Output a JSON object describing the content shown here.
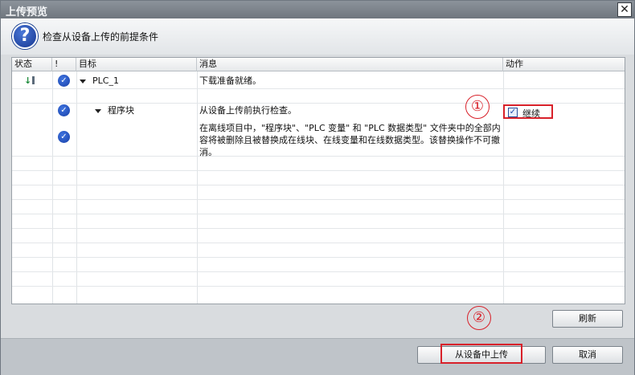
{
  "window": {
    "title": "上传预览",
    "close_label": "✕"
  },
  "header": {
    "icon": "question-icon",
    "text": "检查从设备上传的前提条件"
  },
  "table": {
    "columns": [
      "状态",
      "!",
      "目标",
      "消息",
      "动作"
    ],
    "rows": [
      {
        "target": "PLC_1",
        "message": "下载准备就绪。"
      },
      {
        "target": "程序块",
        "message": "从设备上传前执行检查。",
        "action": "继续"
      },
      {
        "message": "在离线项目中，\"程序块\"、\"PLC 变量\" 和 \"PLC 数据类型\" 文件夹中的全部内容将被删除且被替换成在线块、在线变量和在线数据类型。该替换操作不可撤消。"
      }
    ]
  },
  "annotations": {
    "marker1": "①",
    "marker2": "②"
  },
  "buttons": {
    "refresh": "刷新",
    "upload": "从设备中上传",
    "cancel": "取消"
  },
  "colors": {
    "highlight": "#d8212a",
    "check_blue": "#1840a8"
  }
}
